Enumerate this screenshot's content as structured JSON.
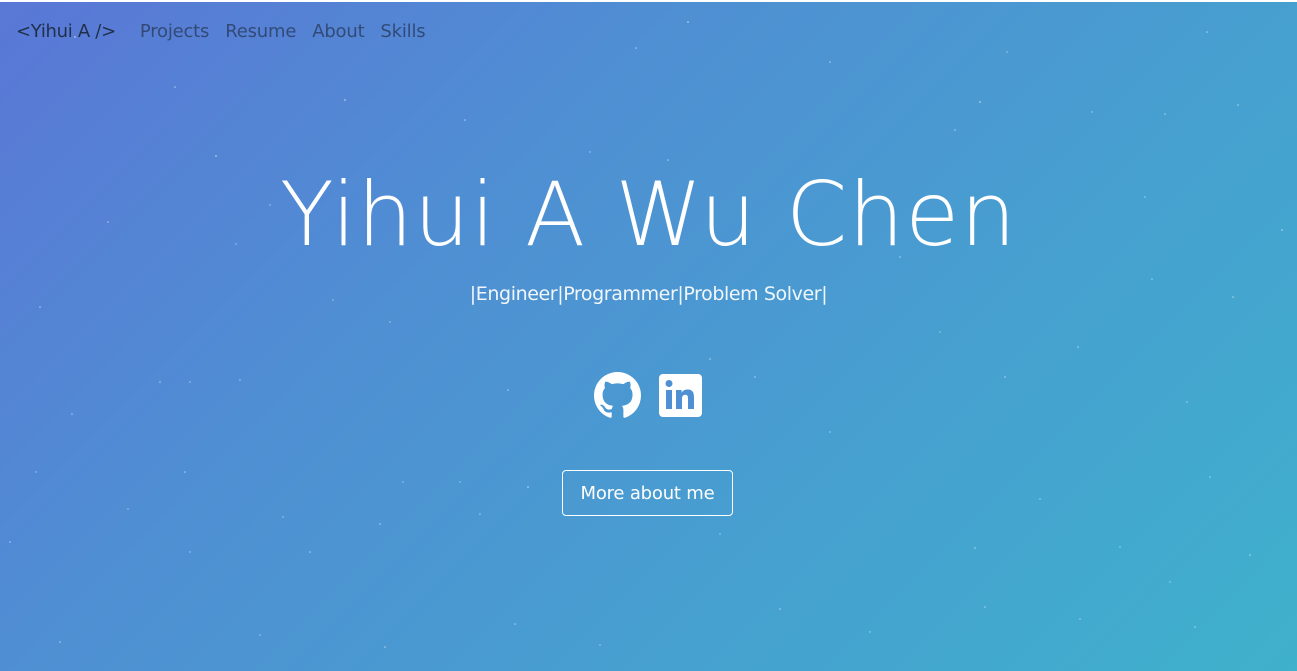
{
  "nav": {
    "brand": "<Yihui A />",
    "links": [
      "Projects",
      "Resume",
      "About",
      "Skills"
    ]
  },
  "hero": {
    "name": "Yihui A Wu Chen",
    "tagline": "|Engineer|Programmer|Problem Solver|",
    "button_label": "More about me"
  },
  "social": {
    "icons": [
      "github-icon",
      "linkedin-icon"
    ]
  },
  "colors": {
    "gradient_start": "#5a77d6",
    "gradient_end": "#3fb1cc",
    "text_light": "#ffffff",
    "nav_text": "#2c4168"
  }
}
